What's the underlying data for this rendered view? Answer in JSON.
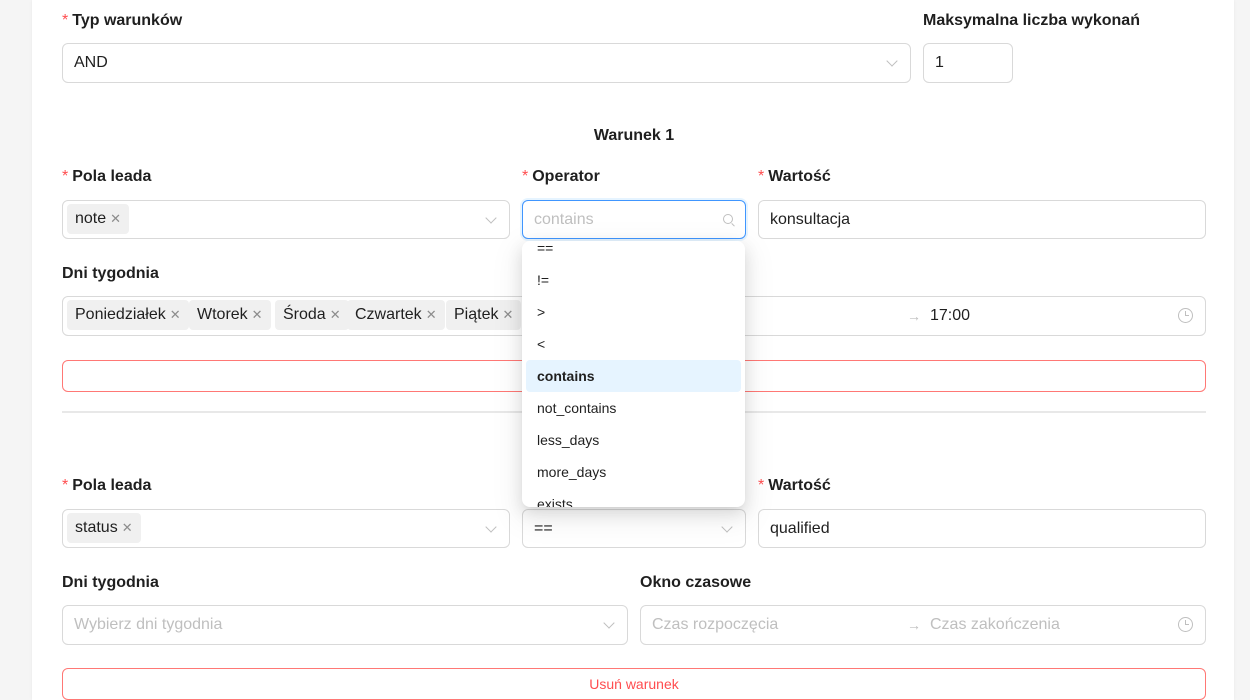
{
  "form": {
    "condition_type": {
      "label": "Typ warunków",
      "value": "AND"
    },
    "max_executions": {
      "label": "Maksymalna liczba wykonań",
      "value": "1"
    }
  },
  "condition1": {
    "title": "Warunek 1",
    "lead_fields": {
      "label": "Pola leada",
      "tags": [
        "note"
      ]
    },
    "operator": {
      "label": "Operator",
      "search_value": "contains"
    },
    "value": {
      "label": "Wartość",
      "value": "konsultacja"
    },
    "weekdays": {
      "label": "Dni tygodnia",
      "tags": [
        "Poniedziałek",
        "Wtorek",
        "Środa",
        "Czwartek",
        "Piątek"
      ]
    },
    "time_window": {
      "end_value": "17:00"
    }
  },
  "operator_dropdown": {
    "options": [
      "==",
      "!=",
      ">",
      "<",
      "contains",
      "not_contains",
      "less_days",
      "more_days",
      "exists"
    ],
    "selected": "contains"
  },
  "condition2": {
    "lead_fields": {
      "label": "Pola leada",
      "tags": [
        "status"
      ]
    },
    "operator": {
      "value": "=="
    },
    "value": {
      "label": "Wartość",
      "value": "qualified"
    },
    "weekdays": {
      "label": "Dni tygodnia",
      "placeholder": "Wybierz dni tygodnia"
    },
    "time_window": {
      "label": "Okno czasowe",
      "start_placeholder": "Czas rozpoczęcia",
      "end_placeholder": "Czas zakończenia"
    },
    "remove_button": "Usuń warunek"
  },
  "icons": {
    "remove_tag": "close-icon",
    "select_arrow": "chevron-down-icon",
    "search": "search-icon",
    "time": "clock-icon",
    "range_separator": "arrow-right-icon"
  },
  "colors": {
    "required": "#ff4d4f",
    "selected_option_bg": "#e6f4ff",
    "danger_border": "#ff7875"
  }
}
